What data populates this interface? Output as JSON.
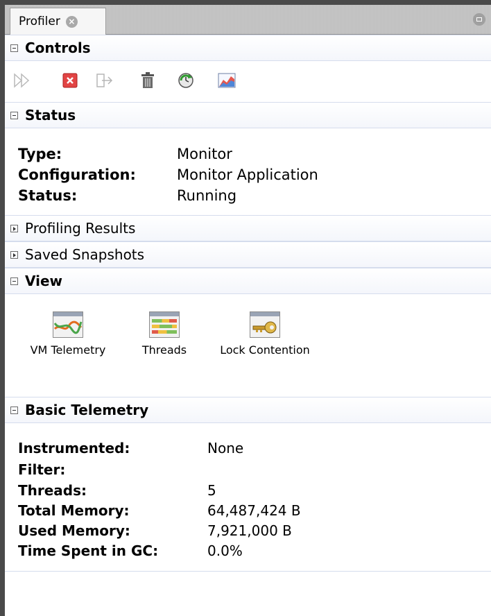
{
  "window": {
    "tab_label": "Profiler"
  },
  "controls": {
    "header": "Controls",
    "buttons": [
      {
        "name": "rerun-profiling-icon"
      },
      {
        "name": "stop-icon"
      },
      {
        "name": "detach-icon"
      },
      {
        "name": "trash-icon"
      },
      {
        "name": "reset-results-icon"
      },
      {
        "name": "vm-telemetry-chart-icon"
      }
    ]
  },
  "status": {
    "header": "Status",
    "rows": [
      {
        "label": "Type:",
        "value": "Monitor"
      },
      {
        "label": "Configuration:",
        "value": "Monitor Application"
      },
      {
        "label": "Status:",
        "value": "Running"
      }
    ]
  },
  "sections": {
    "profiling_results": "Profiling Results",
    "saved_snapshots": "Saved Snapshots"
  },
  "view": {
    "header": "View",
    "items": [
      {
        "label": "VM Telemetry"
      },
      {
        "label": "Threads"
      },
      {
        "label": "Lock Contention"
      }
    ]
  },
  "telemetry": {
    "header": "Basic Telemetry",
    "rows": [
      {
        "label": "Instrumented:",
        "value": "None"
      },
      {
        "label": "Filter:",
        "value": ""
      },
      {
        "label": "Threads:",
        "value": "5"
      },
      {
        "label": "Total Memory:",
        "value": "64,487,424 B"
      },
      {
        "label": "Used Memory:",
        "value": "7,921,000 B"
      },
      {
        "label": "Time Spent in GC:",
        "value": "0.0%"
      }
    ]
  }
}
